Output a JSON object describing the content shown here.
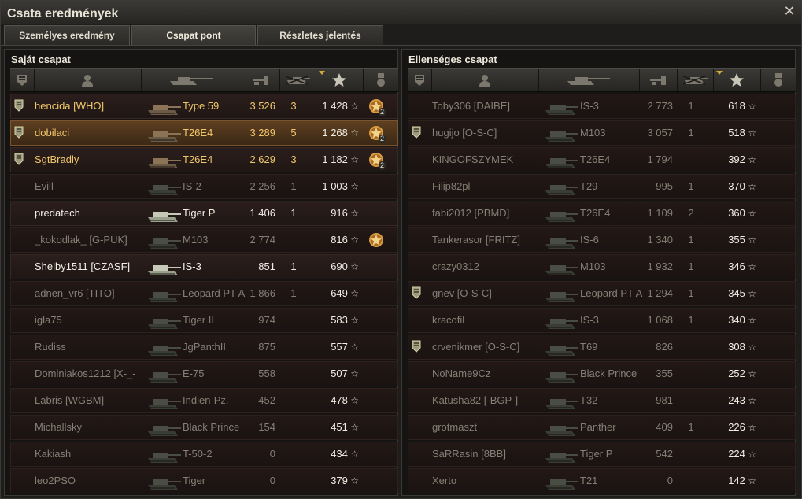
{
  "window": {
    "title": "Csata eredmények",
    "close_icon": "close-icon"
  },
  "tabs": [
    {
      "label": "Személyes eredmény",
      "active": false
    },
    {
      "label": "Csapat pont",
      "active": true
    },
    {
      "label": "Részletes jelentés",
      "active": false
    }
  ],
  "header_icons": [
    "squad-icon",
    "player-icon",
    "tank-icon",
    "damage-icon",
    "kills-icon",
    "score-icon",
    "medal-icon"
  ],
  "own_team": {
    "title": "Saját csapat",
    "rows": [
      {
        "name": "hencida [WHO]",
        "vehicle": "Type 59",
        "damage": "3 526",
        "kills": "3",
        "score": "1 428",
        "style": "gold",
        "badge": true,
        "medal": "2"
      },
      {
        "name": "dobilaci",
        "vehicle": "T26E4",
        "damage": "3 289",
        "kills": "5",
        "score": "1 268",
        "style": "gold",
        "badge": true,
        "medal": "2",
        "me": true
      },
      {
        "name": "SgtBradly",
        "vehicle": "T26E4",
        "damage": "2 629",
        "kills": "3",
        "score": "1 182",
        "style": "gold",
        "badge": true,
        "medal": "2"
      },
      {
        "name": "Evill",
        "vehicle": "IS-2",
        "damage": "2 256",
        "kills": "1",
        "score": "1 003",
        "style": "dim"
      },
      {
        "name": "predatech",
        "vehicle": "Tiger P",
        "damage": "1 406",
        "kills": "1",
        "score": "916",
        "style": "white"
      },
      {
        "name": "_kokodlak_ [G-PUK]",
        "vehicle": "M103",
        "damage": "2 774",
        "kills": "",
        "score": "816",
        "style": "dim",
        "medal": ""
      },
      {
        "name": "Shelby1511 [CZASF]",
        "vehicle": "IS-3",
        "damage": "851",
        "kills": "1",
        "score": "690",
        "style": "white"
      },
      {
        "name": "adnen_vr6 [TITO]",
        "vehicle": "Leopard PT A",
        "damage": "1 866",
        "kills": "1",
        "score": "649",
        "style": "dim"
      },
      {
        "name": "igla75",
        "vehicle": "Tiger II",
        "damage": "974",
        "kills": "",
        "score": "583",
        "style": "dim"
      },
      {
        "name": "Rudiss",
        "vehicle": "JgPanthII",
        "damage": "875",
        "kills": "",
        "score": "557",
        "style": "dim"
      },
      {
        "name": "Dominiakos1212 [X-_-",
        "vehicle": "E-75",
        "damage": "558",
        "kills": "",
        "score": "507",
        "style": "dim"
      },
      {
        "name": "Labris [WGBM]",
        "vehicle": "Indien-Pz.",
        "damage": "452",
        "kills": "",
        "score": "478",
        "style": "dim"
      },
      {
        "name": "Michallsky",
        "vehicle": "Black Prince",
        "damage": "154",
        "kills": "",
        "score": "451",
        "style": "dim"
      },
      {
        "name": "Kakiash",
        "vehicle": "T-50-2",
        "damage": "0",
        "kills": "",
        "score": "434",
        "style": "dim"
      },
      {
        "name": "leo2PSO",
        "vehicle": "Tiger",
        "damage": "0",
        "kills": "",
        "score": "379",
        "style": "dim"
      }
    ]
  },
  "enemy_team": {
    "title": "Ellenséges csapat",
    "rows": [
      {
        "name": "Toby306 [DAIBE]",
        "vehicle": "IS-3",
        "damage": "2 773",
        "kills": "1",
        "score": "618",
        "style": "dim"
      },
      {
        "name": "hugijo [O-S-C]",
        "vehicle": "M103",
        "damage": "3 057",
        "kills": "1",
        "score": "518",
        "style": "dim",
        "badge": true
      },
      {
        "name": "KINGOFSZYMEK",
        "vehicle": "T26E4",
        "damage": "1 794",
        "kills": "",
        "score": "392",
        "style": "dim"
      },
      {
        "name": "Filip82pl",
        "vehicle": "T29",
        "damage": "995",
        "kills": "1",
        "score": "370",
        "style": "dim"
      },
      {
        "name": "fabi2012 [PBMD]",
        "vehicle": "T26E4",
        "damage": "1 109",
        "kills": "2",
        "score": "360",
        "style": "dim"
      },
      {
        "name": "Tankerasor [FRITZ]",
        "vehicle": "IS-6",
        "damage": "1 340",
        "kills": "1",
        "score": "355",
        "style": "dim"
      },
      {
        "name": "crazy0312",
        "vehicle": "M103",
        "damage": "1 932",
        "kills": "1",
        "score": "346",
        "style": "dim"
      },
      {
        "name": "gnev [O-S-C]",
        "vehicle": "Leopard PT A",
        "damage": "1 294",
        "kills": "1",
        "score": "345",
        "style": "dim",
        "badge": true
      },
      {
        "name": "kracofil",
        "vehicle": "IS-3",
        "damage": "1 068",
        "kills": "1",
        "score": "340",
        "style": "dim"
      },
      {
        "name": "crvenikmer [O-S-C]",
        "vehicle": "T69",
        "damage": "826",
        "kills": "",
        "score": "308",
        "style": "dim",
        "badge": true
      },
      {
        "name": "NoName9Cz",
        "vehicle": "Black Prince",
        "damage": "355",
        "kills": "",
        "score": "252",
        "style": "dim"
      },
      {
        "name": "Katusha82 [-BGP-]",
        "vehicle": "T32",
        "damage": "981",
        "kills": "",
        "score": "243",
        "style": "dim"
      },
      {
        "name": "grotmaszt",
        "vehicle": "Panther",
        "damage": "409",
        "kills": "1",
        "score": "226",
        "style": "dim"
      },
      {
        "name": "SaRRasin [8BB]",
        "vehicle": "Tiger P",
        "damage": "542",
        "kills": "",
        "score": "224",
        "style": "dim"
      },
      {
        "name": "Xerto",
        "vehicle": "T21",
        "damage": "0",
        "kills": "",
        "score": "142",
        "style": "dim"
      }
    ]
  }
}
